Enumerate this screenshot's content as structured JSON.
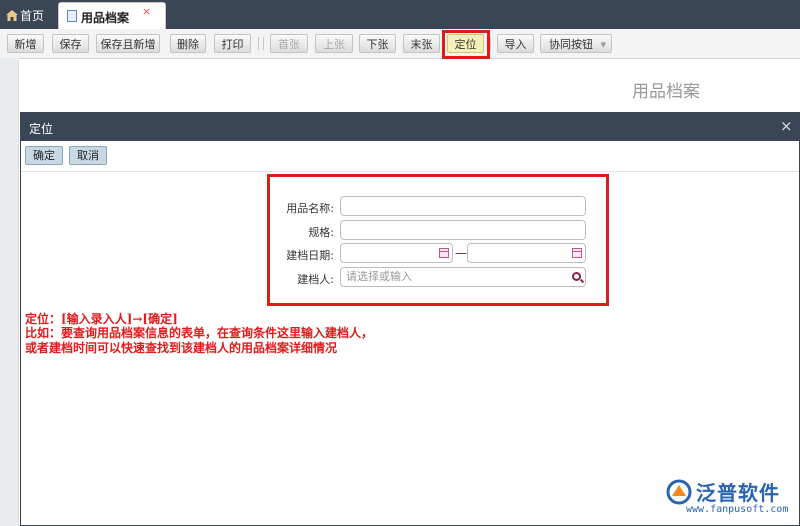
{
  "tabs": {
    "home_label": "首页",
    "active_label": "用品档案",
    "close_glyph": "×"
  },
  "toolbar": {
    "buttons": [
      {
        "label": "新增"
      },
      {
        "label": "保存"
      },
      {
        "label": "保存且新增"
      },
      {
        "label": "删除"
      },
      {
        "label": "打印"
      },
      {
        "label": "首张"
      },
      {
        "label": "上张"
      },
      {
        "label": "下张"
      },
      {
        "label": "末张"
      },
      {
        "label": "定位"
      },
      {
        "label": "导入"
      },
      {
        "label": "协同按钮"
      }
    ],
    "dropdown_glyph": "▾"
  },
  "background": {
    "title": "用品档案"
  },
  "dialog": {
    "title": "定位",
    "close_glyph": "×",
    "confirm_label": "确定",
    "cancel_label": "取消",
    "fields": {
      "name_label": "用品名称:",
      "spec_label": "规格:",
      "date_label": "建档日期:",
      "date_dash": "—",
      "person_label": "建档人:",
      "person_placeholder": "请选择或输入"
    }
  },
  "annotation": {
    "line1": "定位：[输入录入人]→[确定]",
    "line2": "比如：要查询用品档案信息的表单，在查询条件这里输入建档人，",
    "line3": "或者建档时间可以快速查找到该建档人的用品档案详细情况"
  },
  "logo": {
    "name": "泛普软件",
    "url": "www.fanpusoft.com"
  },
  "icons": [
    "home-icon",
    "document-icon",
    "close-icon",
    "calendar-icon",
    "search-icon",
    "dropdown-arrow-icon",
    "fanpu-logo-icon"
  ],
  "colors": {
    "header_bg": "#3a4655",
    "highlight": "#e01b1b",
    "brand": "#2a64b0"
  }
}
